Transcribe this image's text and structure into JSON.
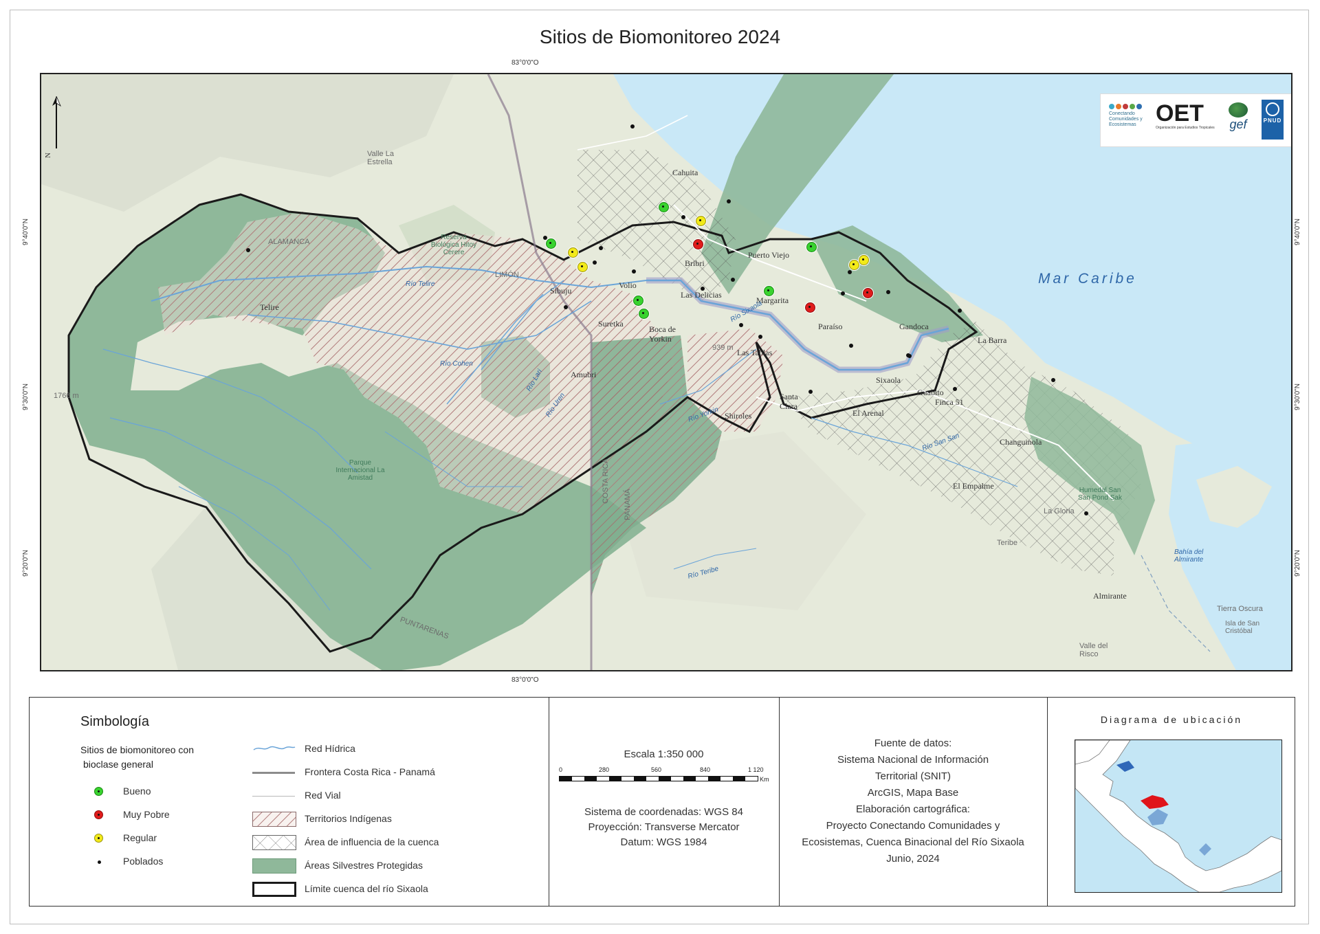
{
  "title": "Sitios de Biomonitoreo 2024",
  "graticule": {
    "lon_label": "83°0'0\"O",
    "lat_40": "9°40'0\"N",
    "lat_30": "9°30'0\"N",
    "lat_20": "9°20'0\"N"
  },
  "north_label": "N",
  "colors": {
    "protected_area": "#8fb89a",
    "sea": "#c9e8f7",
    "indigenous_hatch": "#b07a7a",
    "basin_outline": "#1a1a1a",
    "bueno": "#39d22f",
    "muy_pobre": "#e01c1c",
    "regular": "#f2ea1a",
    "river": "#6aa4d8"
  },
  "map_labels": {
    "sea": "Mar Caribe",
    "places": [
      "Telire",
      "Sibuju",
      "Volio",
      "Suretka",
      "Amubri",
      "Bribri",
      "Las Delicias",
      "Margarita",
      "Boca de Yorkin",
      "Las Tablas",
      "Santa Clara",
      "Shiroles",
      "Sixaola",
      "Guabito",
      "Finca 51",
      "El Arenal",
      "Paraíso",
      "Gandoca",
      "La Barra",
      "Puerto Viejo",
      "Cahuita",
      "Changuinola",
      "El Empalme",
      "Almirante",
      "Tierra Oscura",
      "Isla de San Cristóbal",
      "Bahía del Almirante",
      "Valle del Risco",
      "Valle La Estrella",
      "Teribe",
      "La Gloria"
    ],
    "protected": [
      "Reserva Biológica Hitoy Cerere",
      "Parque Internacional La Amistad",
      "Humedal San San Pond Sak"
    ],
    "rivers": [
      "Río Telire",
      "Río Cohen",
      "Río Lari",
      "Río Uren",
      "Río Yorkin",
      "Río Sixaola",
      "Río San San",
      "Río Teribe"
    ],
    "regions": [
      "LIMÓN",
      "PUNTARENAS",
      "COSTA RICA",
      "PANAMÁ",
      "ALAMANCA"
    ],
    "elevation": "939 m",
    "elev_2": "1766 m"
  },
  "sites": [
    {
      "category": "Bueno"
    },
    {
      "category": "Bueno"
    },
    {
      "category": "Bueno"
    },
    {
      "category": "Bueno"
    },
    {
      "category": "Bueno"
    },
    {
      "category": "Bueno"
    },
    {
      "category": "Muy Pobre"
    },
    {
      "category": "Muy Pobre"
    },
    {
      "category": "Muy Pobre"
    },
    {
      "category": "Regular"
    },
    {
      "category": "Regular"
    },
    {
      "category": "Regular"
    },
    {
      "category": "Regular"
    },
    {
      "category": "Regular"
    }
  ],
  "logos": {
    "conectando": "Conectando Comunidades y Ecosistemas",
    "oet": "OET",
    "oet_sub": "Organización para Estudios Tropicales",
    "gef": "gef",
    "pnud": "PNUD"
  },
  "legend": {
    "title": "Simbología",
    "subtitle_1": "Sitios de biomonitoreo con",
    "subtitle_2": "bioclase general",
    "bueno": "Bueno",
    "muy_pobre": "Muy Pobre",
    "regular": "Regular",
    "poblados": "Poblados",
    "red_hidrica": "Red Hídrica",
    "frontera": "Frontera Costa Rica - Panamá",
    "red_vial": "Red Vial",
    "territorios": "Territorios Indígenas",
    "influencia": "Área de influencia de la cuenca",
    "areas_protegidas": "Áreas Silvestres Protegidas",
    "limite": "Límite cuenca del río Sixaola"
  },
  "scale": {
    "label": "Escala 1:350 000",
    "ticks": [
      "0",
      "280",
      "560",
      "840",
      "1 120"
    ],
    "unit": "Km",
    "crs": "Sistema de coordenadas: WGS 84",
    "projection": "Proyección: Transverse Mercator",
    "datum": "Datum: WGS 1984"
  },
  "sources": {
    "l1": "Fuente de datos:",
    "l2": "Sistema Nacional de Información",
    "l3": "Territorial (SNIT)",
    "l4": "ArcGIS, Mapa Base",
    "l5": "Elaboración cartográfica:",
    "l6": "Proyecto Conectando Comunidades y",
    "l7": "Ecosistemas, Cuenca Binacional del Río Sixaola",
    "l8": "Junio, 2024"
  },
  "inset": {
    "title": "Diagrama de ubicación"
  }
}
